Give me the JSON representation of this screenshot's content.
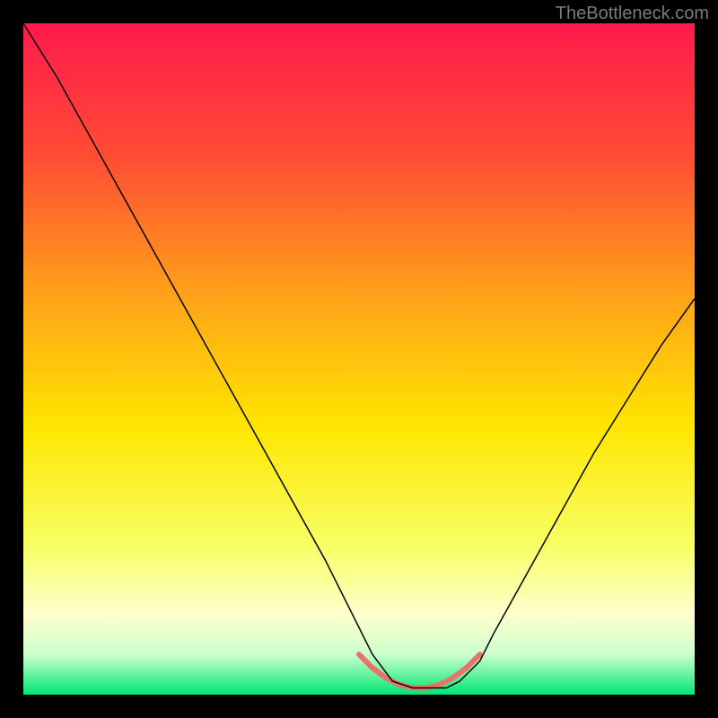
{
  "watermark": "TheBottleneck.com",
  "chart_data": {
    "type": "line",
    "title": "",
    "xlabel": "",
    "ylabel": "",
    "xlim": [
      0,
      100
    ],
    "ylim": [
      0,
      100
    ],
    "background": {
      "type": "vertical-gradient",
      "stops": [
        {
          "offset": 0,
          "color": "#ff1a4d"
        },
        {
          "offset": 20,
          "color": "#ff4d33"
        },
        {
          "offset": 40,
          "color": "#ffa01a"
        },
        {
          "offset": 60,
          "color": "#ffe600"
        },
        {
          "offset": 78,
          "color": "#f7ff66"
        },
        {
          "offset": 88,
          "color": "#ffffcc"
        },
        {
          "offset": 94,
          "color": "#ccffcc"
        },
        {
          "offset": 100,
          "color": "#00e673"
        }
      ]
    },
    "series": [
      {
        "name": "bottleneck-curve",
        "color": "#000000",
        "width": 1.5,
        "x": [
          0,
          5,
          10,
          15,
          20,
          25,
          30,
          35,
          40,
          45,
          50,
          52,
          55,
          58,
          60,
          63,
          65,
          68,
          70,
          75,
          80,
          85,
          90,
          95,
          100
        ],
        "values": [
          100,
          92,
          83,
          74,
          65,
          56,
          47,
          38,
          29,
          20,
          10,
          6,
          2,
          1,
          1,
          1,
          2,
          5,
          9,
          18,
          27,
          36,
          44,
          52,
          59
        ]
      },
      {
        "name": "optimal-zone-highlight",
        "color": "#e8736b",
        "width": 6,
        "x": [
          50,
          52,
          54,
          56,
          58,
          60,
          62,
          64,
          66,
          68
        ],
        "values": [
          6,
          4,
          2.5,
          1.5,
          1,
          1,
          1.5,
          2.5,
          4,
          6
        ]
      }
    ]
  }
}
